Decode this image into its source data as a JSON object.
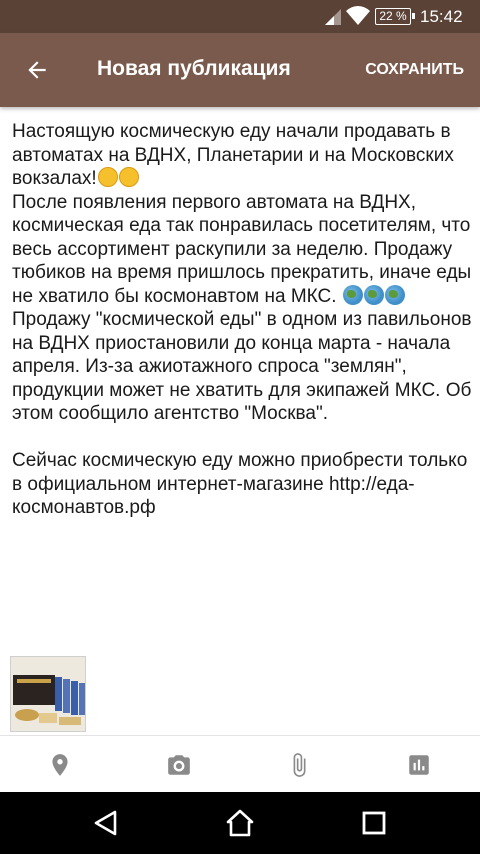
{
  "status_bar": {
    "battery": "22 %",
    "time": "15:42",
    "icons": [
      "signal-icon",
      "wifi-icon",
      "battery-icon"
    ]
  },
  "app_bar": {
    "title": "Новая публикация",
    "save_label": "СОХРАНИТЬ",
    "back_icon": "arrow-back-icon",
    "background": "#7a5a4c",
    "status_background": "#5b4236"
  },
  "post": {
    "line1": "Настоящую космическую еду начали продавать в автоматах на ВДНХ, Планетарии и на Московских вокзалах!",
    "line1_emojis": [
      "thinking-face-emoji",
      "grinning-face-emoji"
    ],
    "line2": "После появления первого автомата на ВДНХ, космическая еда так понравилась посетителям, что весь ассортимент раскупили за неделю. Продажу тюбиков на время пришлось прекратить, иначе еды не хватило бы космонавтом на МКС.",
    "line2_emojis": [
      "globe-emoji",
      "globe-emoji",
      "globe-emoji"
    ],
    "line3": "Продажу \"космической еды\" в одном из павильонов на ВДНХ приостановили до конца марта - начала апреля. Из-за ажиотажного спроса \"землян\", продукции может не хватить для экипажей МКС. Об этом сообщило агентство \"Москва\".",
    "line4": "Сейчас космическую еду можно приобрести только в официальном интернет-магазине http://еда-космонавтов.рф"
  },
  "toolbar": {
    "icons": [
      "location-icon",
      "camera-icon",
      "attachment-icon",
      "poll-icon"
    ],
    "icon_color": "#8a8a8a"
  },
  "nav_bar": {
    "icons": [
      "back-nav-icon",
      "home-nav-icon",
      "recents-nav-icon"
    ]
  }
}
